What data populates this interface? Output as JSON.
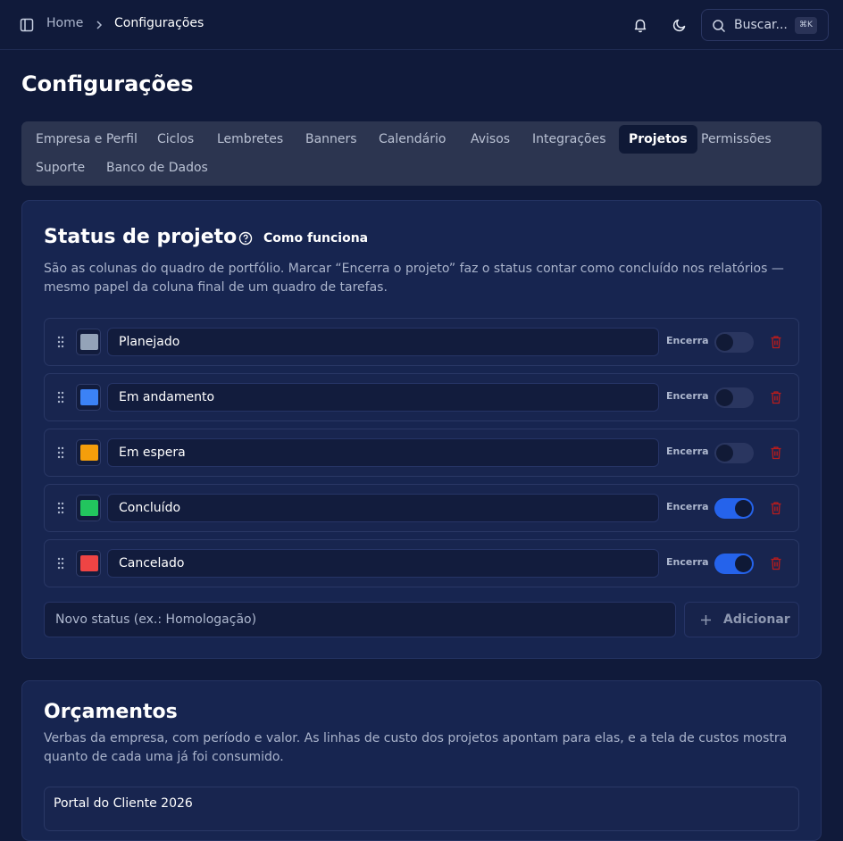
{
  "header": {
    "breadcrumb_home": "Home",
    "breadcrumb_current": "Configurações",
    "search_label": "Buscar...",
    "search_shortcut": "⌘K"
  },
  "page": {
    "title": "Configurações"
  },
  "tabs": [
    {
      "label": "Empresa e Perfil",
      "active": false
    },
    {
      "label": "Ciclos",
      "active": false
    },
    {
      "label": "Lembretes",
      "active": false
    },
    {
      "label": "Banners",
      "active": false
    },
    {
      "label": "Calendário",
      "active": false
    },
    {
      "label": "Avisos",
      "active": false
    },
    {
      "label": "Integrações",
      "active": false
    },
    {
      "label": "Projetos",
      "active": true
    },
    {
      "label": "Permissões",
      "active": false
    },
    {
      "label": "Suporte",
      "active": false
    },
    {
      "label": "Banco de Dados",
      "active": false
    }
  ],
  "status_section": {
    "title": "Status de projeto",
    "help_label": "Como funciona",
    "description": "São as colunas do quadro de portfólio. Marcar “Encerra o projeto” faz o status contar como concluído nos relatórios — mesmo papel da coluna final de um quadro de tarefas.",
    "toggle_label": "Encerra",
    "statuses": [
      {
        "name": "Planejado",
        "color": "#94a3b8",
        "closes": false
      },
      {
        "name": "Em andamento",
        "color": "#3b82f6",
        "closes": false
      },
      {
        "name": "Em espera",
        "color": "#f59e0b",
        "closes": false
      },
      {
        "name": "Concluído",
        "color": "#22c55e",
        "closes": true
      },
      {
        "name": "Cancelado",
        "color": "#ef4444",
        "closes": true
      }
    ],
    "new_status_placeholder": "Novo status (ex.: Homologação)",
    "add_button_label": "Adicionar"
  },
  "budget_section": {
    "title": "Orçamentos",
    "description": "Verbas da empresa, com período e valor. As linhas de custo dos projetos apontam para elas, e a tela de custos mostra quanto de cada uma já foi consumido.",
    "budgets": [
      {
        "name": "Portal do Cliente 2026"
      }
    ]
  },
  "colors": {
    "accent": "#2563eb",
    "danger": "#b91c1c",
    "background": "#101a3a"
  }
}
